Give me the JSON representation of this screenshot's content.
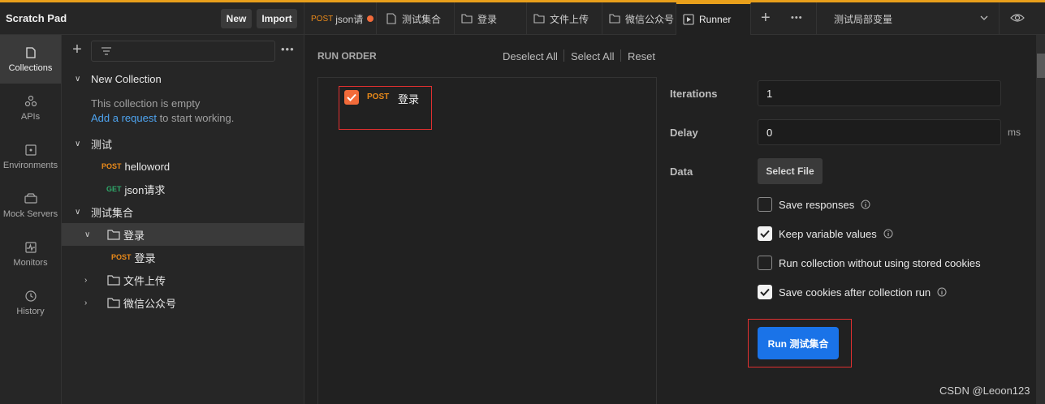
{
  "header": {
    "title": "Scratch Pad",
    "new_label": "New",
    "import_label": "Import"
  },
  "rail": [
    {
      "label": "Collections",
      "icon": "collections-icon"
    },
    {
      "label": "APIs",
      "icon": "apis-icon"
    },
    {
      "label": "Environments",
      "icon": "environments-icon"
    },
    {
      "label": "Mock Servers",
      "icon": "mock-servers-icon"
    },
    {
      "label": "Monitors",
      "icon": "monitors-icon"
    },
    {
      "label": "History",
      "icon": "history-icon"
    }
  ],
  "sidebar": {
    "new_collection": "New Collection",
    "empty_text": "This collection is empty",
    "add_request": "Add a request",
    "to_start": " to start working.",
    "test_collection": "测试",
    "req_helloword_method": "POST",
    "req_helloword": "helloword",
    "req_json_method": "GET",
    "req_json": "json请求",
    "set_collection": "测试集合",
    "folder_login": "登录",
    "req_login_method": "POST",
    "req_login": "登录",
    "folder_upload": "文件上传",
    "folder_wechat": "微信公众号"
  },
  "tabs": {
    "t1_method": "POST",
    "t1_name": "json请",
    "t2": "测试集合",
    "t3": "登录",
    "t4": "文件上传",
    "t5": "微信公众号",
    "t6": "Runner",
    "env": "测试局部变量"
  },
  "runner": {
    "run_order": "RUN ORDER",
    "deselect_all": "Deselect All",
    "select_all": "Select All",
    "reset": "Reset",
    "request_method": "POST",
    "request_name": "登录",
    "iterations_label": "Iterations",
    "iterations_value": "1",
    "delay_label": "Delay",
    "delay_value": "0",
    "delay_unit": "ms",
    "data_label": "Data",
    "select_file": "Select File",
    "save_responses": "Save responses",
    "keep_values": "Keep variable values",
    "no_cookies": "Run collection without using stored cookies",
    "save_cookies": "Save cookies after collection run",
    "run_button": "Run 测试集合"
  },
  "watermark": "CSDN @Leoon123"
}
